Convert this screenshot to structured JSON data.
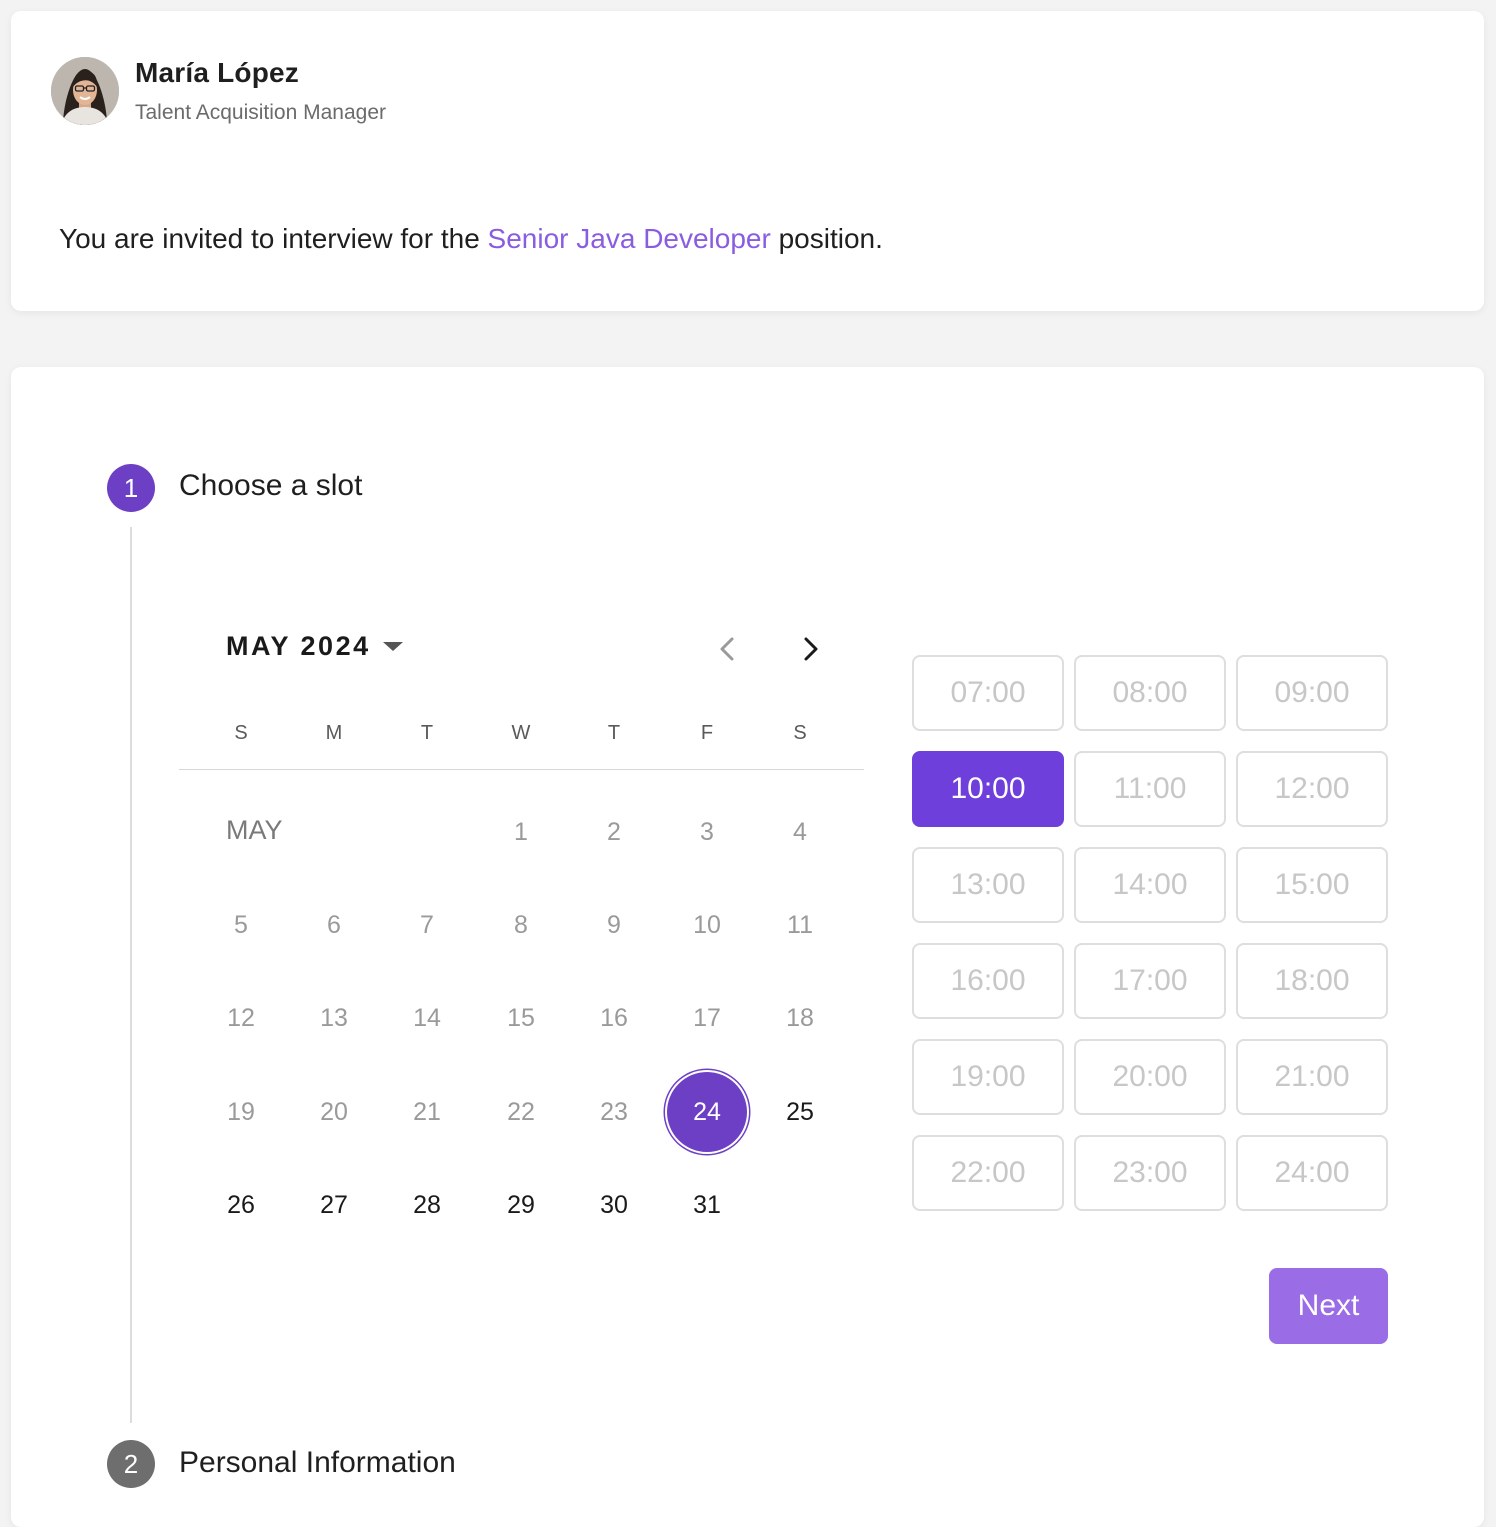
{
  "header": {
    "name": "María López",
    "role": "Talent Acquisition Manager",
    "invite_prefix": "You are invited to interview for the ",
    "position_link": "Senior Java Developer",
    "invite_suffix": " position."
  },
  "steps": [
    {
      "number": "1",
      "label": "Choose a slot",
      "state": "active"
    },
    {
      "number": "2",
      "label": "Personal Information",
      "state": "inactive"
    }
  ],
  "calendar": {
    "month_year": "MAY 2024",
    "month_label": "MAY",
    "weekdays": [
      "S",
      "M",
      "T",
      "W",
      "T",
      "F",
      "S"
    ],
    "first_weekday_index": 3,
    "days": [
      "1",
      "2",
      "3",
      "4",
      "5",
      "6",
      "7",
      "8",
      "9",
      "10",
      "11",
      "12",
      "13",
      "14",
      "15",
      "16",
      "17",
      "18",
      "19",
      "20",
      "21",
      "22",
      "23",
      "24",
      "25",
      "26",
      "27",
      "28",
      "29",
      "30",
      "31"
    ],
    "selected_day": "24",
    "first_available_day": 24
  },
  "time_slots": {
    "slots": [
      "07:00",
      "08:00",
      "09:00",
      "10:00",
      "11:00",
      "12:00",
      "13:00",
      "14:00",
      "15:00",
      "16:00",
      "17:00",
      "18:00",
      "19:00",
      "20:00",
      "21:00",
      "22:00",
      "23:00",
      "24:00"
    ],
    "selected": "10:00"
  },
  "actions": {
    "next_label": "Next"
  },
  "colors": {
    "accent": "#6d3fc4",
    "slot_selected": "#6f3fdb",
    "next_button": "#9a6ce6",
    "link": "#8a5ce0"
  }
}
